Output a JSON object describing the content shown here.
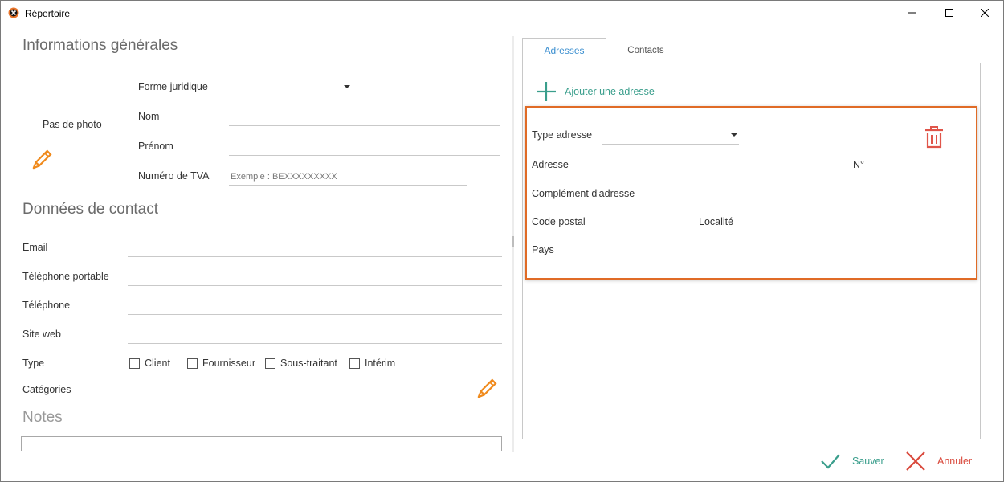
{
  "window": {
    "title": "Répertoire"
  },
  "colors": {
    "accent_orange": "#f08a1c",
    "highlight_border": "#e06b26",
    "green": "#3a9e8c",
    "red": "#d9483b",
    "tab_blue": "#3b8fd0"
  },
  "general": {
    "section_title": "Informations générales",
    "photo_label": "Pas de photo",
    "forme_juridique_label": "Forme juridique",
    "nom_label": "Nom",
    "prenom_label": "Prénom",
    "tva_label": "Numéro de TVA",
    "tva_placeholder": "Exemple : BEXXXXXXXXX"
  },
  "contact": {
    "section_title": "Données de contact",
    "email_label": "Email",
    "mobile_label": "Téléphone portable",
    "phone_label": "Téléphone",
    "website_label": "Site web",
    "type_label": "Type",
    "type_options": [
      "Client",
      "Fournisseur",
      "Sous-traitant",
      "Intérim"
    ],
    "categories_label": "Catégories"
  },
  "notes": {
    "section_title": "Notes"
  },
  "tabs": {
    "addresses": "Adresses",
    "contacts": "Contacts"
  },
  "addresses": {
    "add_label": "Ajouter une adresse",
    "type_label": "Type adresse",
    "address_label": "Adresse",
    "number_label": "N°",
    "complement_label": "Complément d'adresse",
    "postal_label": "Code postal",
    "city_label": "Localité",
    "country_label": "Pays"
  },
  "actions": {
    "save": "Sauver",
    "cancel": "Annuler"
  },
  "icons": {
    "app": "app-logo-icon",
    "photo_edit": "pencil-icon",
    "categories_edit": "pencil-icon",
    "add": "plus-icon",
    "delete": "trash-icon",
    "save": "checkmark-icon",
    "cancel": "cross-icon"
  }
}
